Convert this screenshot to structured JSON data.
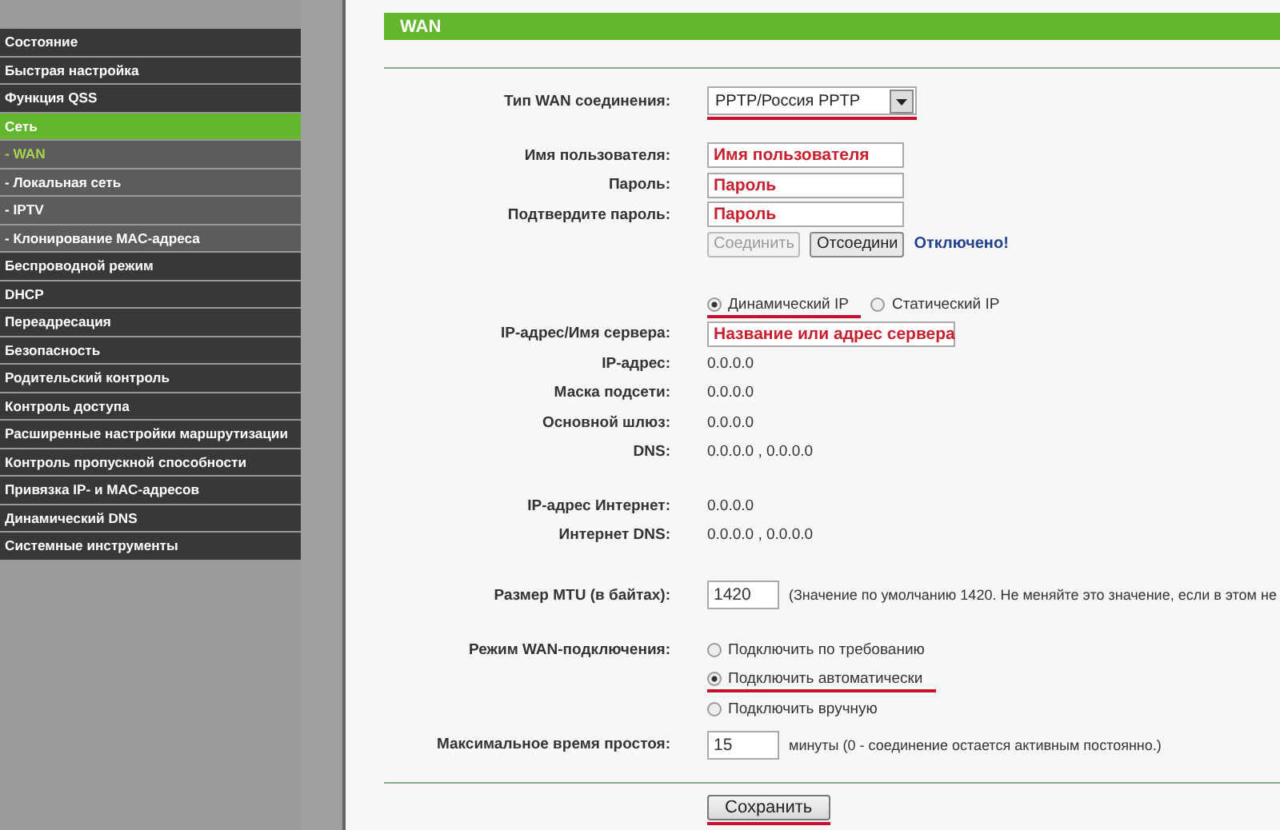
{
  "sidebar": {
    "items": [
      {
        "label": "Состояние",
        "kind": "main",
        "selected": false
      },
      {
        "label": "Быстрая настройка",
        "kind": "main",
        "selected": false
      },
      {
        "label": "Функция QSS",
        "kind": "main",
        "selected": false
      },
      {
        "label": "Сеть",
        "kind": "main",
        "selected": true
      },
      {
        "label": "- WAN",
        "kind": "sub",
        "selected": true
      },
      {
        "label": "- Локальная сеть",
        "kind": "sub",
        "selected": false
      },
      {
        "label": "- IPTV",
        "kind": "sub",
        "selected": false
      },
      {
        "label": "- Клонирование MAC-адреса",
        "kind": "sub",
        "selected": false
      },
      {
        "label": "Беспроводной режим",
        "kind": "main",
        "selected": false
      },
      {
        "label": "DHCP",
        "kind": "main",
        "selected": false
      },
      {
        "label": "Переадресация",
        "kind": "main",
        "selected": false
      },
      {
        "label": "Безопасность",
        "kind": "main",
        "selected": false
      },
      {
        "label": "Родительский контроль",
        "kind": "main",
        "selected": false
      },
      {
        "label": "Контроль доступа",
        "kind": "main",
        "selected": false
      },
      {
        "label": "Расширенные настройки маршрутизации",
        "kind": "main",
        "selected": false
      },
      {
        "label": "Контроль пропускной способности",
        "kind": "main",
        "selected": false
      },
      {
        "label": "Привязка IP- и MAC-адресов",
        "kind": "main",
        "selected": false
      },
      {
        "label": "Динамический DNS",
        "kind": "main",
        "selected": false
      },
      {
        "label": "Системные инструменты",
        "kind": "main",
        "selected": false
      }
    ]
  },
  "header": {
    "title": "WAN"
  },
  "wan_type": {
    "label": "Тип WAN соединения:",
    "value": "PPTP/Россия PPTP",
    "underlined": true
  },
  "credentials": [
    {
      "label": "Имя пользователя:",
      "value": "Имя пользователя"
    },
    {
      "label": "Пароль:",
      "value": "Пароль"
    },
    {
      "label": "Подтвердите пароль:",
      "value": "Пароль"
    }
  ],
  "connect_buttons": [
    {
      "label": "Соединить",
      "disabled": true
    },
    {
      "label": "Отсоедини",
      "disabled": false
    }
  ],
  "status": "Отключено!",
  "ip_mode": [
    {
      "label": "Динамический IP",
      "selected": true,
      "underlined": true
    },
    {
      "label": "Статический IP",
      "selected": false,
      "underlined": false
    }
  ],
  "server": {
    "label": "IP-адрес/Имя сервера:",
    "value": "Название или адрес сервера"
  },
  "info": [
    {
      "label": "IP-адрес:",
      "value": "0.0.0.0"
    },
    {
      "label": "Маска подсети:",
      "value": "0.0.0.0"
    },
    {
      "label": "Основной шлюз:",
      "value": "0.0.0.0"
    },
    {
      "label": "DNS:",
      "value": "0.0.0.0 , 0.0.0.0"
    }
  ],
  "internet_info": [
    {
      "label": "IP-адрес Интернет:",
      "value": "0.0.0.0"
    },
    {
      "label": "Интернет DNS:",
      "value": "0.0.0.0 , 0.0.0.0"
    }
  ],
  "mtu": {
    "label": "Размер MTU (в байтах):",
    "value": "1420",
    "note": "(Значение по умолчанию 1420. Не меняйте это значение, если в этом не"
  },
  "connection_mode": {
    "label": "Режим WAN-подключения:",
    "options": [
      {
        "label": "Подключить по требованию",
        "selected": false,
        "underlined": false
      },
      {
        "label": "Подключить автоматически",
        "selected": true,
        "underlined": true
      },
      {
        "label": "Подключить вручную",
        "selected": false,
        "underlined": false
      }
    ]
  },
  "idle": {
    "label": "Максимальное время простоя:",
    "value": "15",
    "note": "минуты (0 - соединение остается активным постоянно.)"
  },
  "save": {
    "label": "Сохранить",
    "underlined": true
  }
}
